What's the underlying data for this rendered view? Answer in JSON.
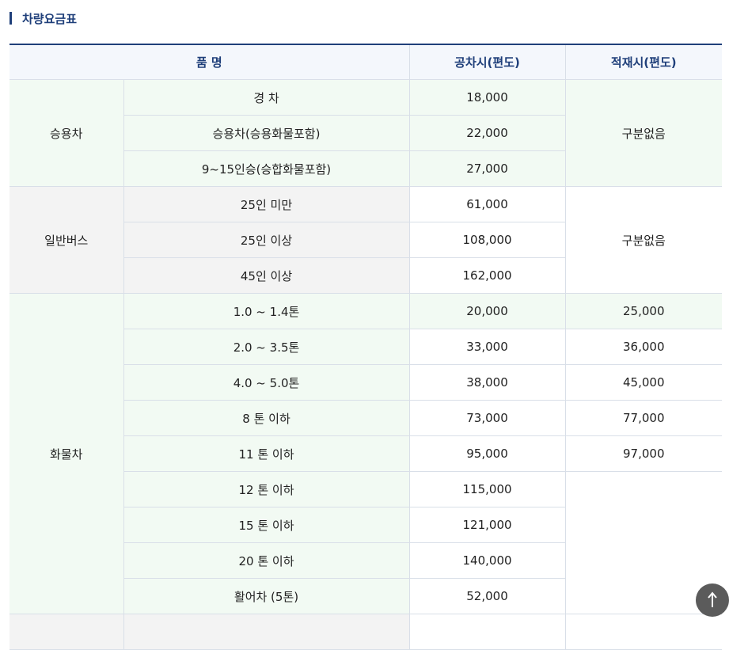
{
  "section": {
    "title": "차량요금표"
  },
  "table": {
    "headers": {
      "item": "품 명",
      "empty": "공차시(편도)",
      "loaded": "적재시(편도)"
    },
    "groups": {
      "car": {
        "label": "승용차",
        "rows": [
          {
            "name": "경 차",
            "empty_fare": "18,000"
          },
          {
            "name": "승용차(승용화물포함)",
            "empty_fare": "22,000"
          },
          {
            "name": "9~15인승(승합화물포함)",
            "empty_fare": "27,000"
          }
        ],
        "loaded_fare": "구분없음"
      },
      "bus": {
        "label": "일반버스",
        "rows": [
          {
            "name": "25인 미만",
            "empty_fare": "61,000"
          },
          {
            "name": "25인 이상",
            "empty_fare": "108,000"
          },
          {
            "name": "45인 이상",
            "empty_fare": "162,000"
          }
        ],
        "loaded_fare": "구분없음"
      },
      "truck": {
        "label": "화물차",
        "rows": [
          {
            "name": "1.0 ~ 1.4톤",
            "empty_fare": "20,000",
            "loaded_fare": "25,000"
          },
          {
            "name": "2.0 ~ 3.5톤",
            "empty_fare": "33,000",
            "loaded_fare": "36,000"
          },
          {
            "name": "4.0 ~ 5.0톤",
            "empty_fare": "38,000",
            "loaded_fare": "45,000"
          },
          {
            "name": "8 톤 이하",
            "empty_fare": "73,000",
            "loaded_fare": "77,000"
          },
          {
            "name": "11 톤 이하",
            "empty_fare": "95,000",
            "loaded_fare": "97,000"
          },
          {
            "name": "12 톤 이하",
            "empty_fare": "115,000"
          },
          {
            "name": "15 톤 이하",
            "empty_fare": "121,000"
          },
          {
            "name": "20 톤 이하",
            "empty_fare": "140,000"
          },
          {
            "name": "활어차 (5톤)",
            "empty_fare": "52,000"
          }
        ]
      }
    }
  },
  "scroll_top": {
    "icon": "arrow-up-icon"
  }
}
